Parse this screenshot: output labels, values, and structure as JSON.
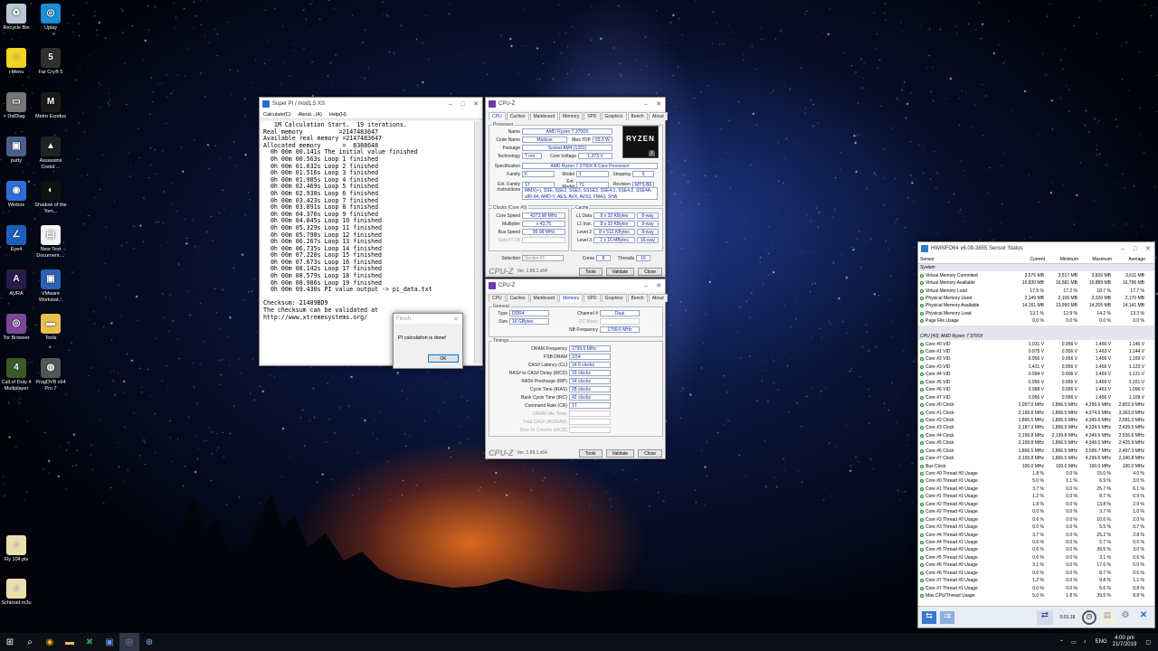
{
  "desktop": {
    "icons": [
      {
        "label": "Recycle Bin",
        "icon": "recycle-bin-icon",
        "color": "#b8c6d8",
        "glyph": "♻"
      },
      {
        "label": "Uplay",
        "icon": "uplay-icon",
        "color": "#1b8fd8",
        "glyph": "◎"
      },
      {
        "label": "i-Menu",
        "icon": "smiley-icon",
        "color": "#f4d320",
        "glyph": "☺"
      },
      {
        "label": "Far Cry® 5",
        "icon": "far-cry-5-icon",
        "color": "#303030",
        "glyph": "5"
      },
      {
        "label": "DslDiag",
        "icon": "dsldiag-icon",
        "color": "#777",
        "glyph": "▭"
      },
      {
        "label": "Metro Exodus",
        "icon": "metro-exodus-icon",
        "color": "#1a1a1a",
        "glyph": "M"
      },
      {
        "label": "putty",
        "icon": "putty-icon",
        "color": "#4a5e8c",
        "glyph": "▣"
      },
      {
        "label": "Assassins Creed ...",
        "icon": "assassins-creed-icon",
        "color": "#222",
        "glyph": "▲"
      },
      {
        "label": "Winbox",
        "icon": "winbox-icon",
        "color": "#2d6fd8",
        "glyph": "◉"
      },
      {
        "label": "Shadow of the Tom...",
        "icon": "shadow-tomb-raider-icon",
        "color": "#111",
        "glyph": "◐"
      },
      {
        "label": "Eye4",
        "icon": "eye4-icon",
        "color": "#1c5fbc",
        "glyph": "∠"
      },
      {
        "label": "New Text Document....",
        "icon": "text-document-icon",
        "color": "#f4f4f4",
        "glyph": "▤"
      },
      {
        "label": "AURA",
        "icon": "aura-icon",
        "color": "#2a1a4a",
        "glyph": "A"
      },
      {
        "label": "VMware Workstat...",
        "icon": "vmware-icon",
        "color": "#2b62b4",
        "glyph": "▣"
      },
      {
        "label": "Tor Browser",
        "icon": "tor-browser-icon",
        "color": "#7d4698",
        "glyph": "◎"
      },
      {
        "label": "Tools",
        "icon": "folder-icon",
        "color": "#e8c050",
        "glyph": "▬"
      },
      {
        "label": "Call of Duty 4 Multiplayer",
        "icon": "call-of-duty-icon",
        "color": "#3a5a2a",
        "glyph": "4"
      },
      {
        "label": "ProgDVB x64 Pro 7",
        "icon": "progdvb-icon",
        "color": "#555",
        "glyph": "◍"
      },
      {
        "label": "Fly 104.pls",
        "icon": "playlist-file-icon",
        "color": "#e9e0b0",
        "glyph": "♫"
      },
      {
        "label": "Schizoid.m3u",
        "icon": "m3u-file-icon",
        "color": "#e9e0b0",
        "glyph": "♫"
      }
    ]
  },
  "superpi": {
    "title": "Super PI / mod1.5 XS",
    "menu": [
      "Calculate(C)",
      "About...(A)",
      "Help(H)"
    ],
    "lines": [
      "   1M Calculation Start.  19 iterations.",
      "Real memory          =2147483647",
      "Available real memory =2147483647",
      "Allocated memory      =  8388648",
      "  0h 00m 00.141s The initial value finished",
      "  0h 00m 00.563s Loop 1 finished",
      "  0h 00m 01.032s Loop 2 finished",
      "  0h 00m 01.516s Loop 3 finished",
      "  0h 00m 01.985s Loop 4 finished",
      "  0h 00m 02.469s Loop 5 finished",
      "  0h 00m 02.938s Loop 6 finished",
      "  0h 00m 03.423s Loop 7 finished",
      "  0h 00m 03.891s Loop 8 finished",
      "  0h 00m 04.376s Loop 9 finished",
      "  0h 00m 04.845s Loop 10 finished",
      "  0h 00m 05.329s Loop 11 finished",
      "  0h 00m 05.798s Loop 12 finished",
      "  0h 00m 06.267s Loop 13 finished",
      "  0h 00m 06.735s Loop 14 finished",
      "  0h 00m 07.220s Loop 15 finished",
      "  0h 00m 07.673s Loop 16 finished",
      "  0h 00m 08.142s Loop 17 finished",
      "  0h 00m 08.579s Loop 18 finished",
      "  0h 00m 08.986s Loop 19 finished",
      "  0h 00m 09.430s PI value output -> pi_data.txt",
      "",
      "Checksum: 21489BD9",
      "The checksum can be validated at",
      "http://www.xtremesystems.org/"
    ]
  },
  "finish": {
    "title": "Finish",
    "message": "PI calculation is done!",
    "ok": "OK"
  },
  "cpuz1": {
    "title": "CPU-Z",
    "tabs": [
      "CPU",
      "Caches",
      "Mainboard",
      "Memory",
      "SPD",
      "Graphics",
      "Bench",
      "About"
    ],
    "active": 0,
    "processor_title": "Processor",
    "name_l": "Name",
    "name": "AMD Ryzen 7 3700X",
    "code_l": "Code Name",
    "code": "Matisse",
    "tdp_l": "Max TDP",
    "tdp": "65.0 W",
    "pkg_l": "Package",
    "pkg": "Socket AM4 (1331)",
    "tech_l": "Technology",
    "tech": "7 nm",
    "volt_l": "Core Voltage",
    "volt": "1.373 V",
    "spec_l": "Specification",
    "spec": "AMD Ryzen 7 3700X 8-Core Processor",
    "fam_l": "Family",
    "fam": "F",
    "model_l": "Model",
    "model": "1",
    "step_l": "Stepping",
    "step": "0",
    "efam_l": "Ext. Family",
    "efam": "17",
    "emodel_l": "Ext. Model",
    "emodel": "71",
    "rev_l": "Revision",
    "rev": "MTS-B0",
    "inst_l": "Instructions",
    "inst1": "MMX(+), SSE, SSE2, SSE3, SSSE3, SSE4.1, SSE4.2, SSE4A,",
    "inst2": "x86-64, AMD-V, AES, AVX, AVX2, FMA3, SHA",
    "logo_text": "RYZEN",
    "logo_sub": "7",
    "clocks_title": "Clocks (Core #0)",
    "cs_l": "Core Speed",
    "cs": "4373.98 MHz",
    "mul_l": "Multiplier",
    "mul": "x 43.75",
    "bus_l": "Bus Speed",
    "bus": "99.98 MHz",
    "fsb_l": "Rated FSB",
    "cache_title": "Cache",
    "caches": [
      {
        "l": "L1 Data",
        "v": "8 x 32 KBytes",
        "w": "8-way"
      },
      {
        "l": "L1 Inst.",
        "v": "8 x 32 KBytes",
        "w": "8-way"
      },
      {
        "l": "Level 2",
        "v": "8 x 512 KBytes",
        "w": "8-way"
      },
      {
        "l": "Level 3",
        "v": "2 x 16 MBytes",
        "w": "16-way"
      }
    ],
    "sel_l": "Selection",
    "sel": "Socket #1",
    "cores_l": "Cores",
    "cores": "8",
    "threads_l": "Threads",
    "threads": "16",
    "ver": "Ver. 1.89.1.x64",
    "tools": "Tools",
    "validate": "Validate",
    "close": "Close",
    "brand": "CPU-Z"
  },
  "cpuz2": {
    "title": "CPU-Z",
    "active": 3,
    "general_title": "General",
    "type_l": "Type",
    "type": "DDR4",
    "chan_l": "Channel #",
    "chan": "Dual",
    "size_l": "Size",
    "size": "16 GBytes",
    "dc_l": "DC Mode",
    "nb_l": "NB Frequency",
    "nb": "1799.6 MHz",
    "timings_title": "Timings",
    "timings": [
      {
        "l": "DRAM Frequency",
        "v": "1799.6 MHz"
      },
      {
        "l": "FSB:DRAM",
        "v": "3:54"
      },
      {
        "l": "CAS# Latency (CL)",
        "v": "14.0 clocks"
      },
      {
        "l": "RAS# to CAS# Delay (tRCD)",
        "v": "15 clocks"
      },
      {
        "l": "RAS# Precharge (tRP)",
        "v": "14 clocks"
      },
      {
        "l": "Cycle Time (tRAS)",
        "v": "28 clocks"
      },
      {
        "l": "Bank Cycle Time (tRC)",
        "v": "42 clocks"
      },
      {
        "l": "Command Rate (CR)",
        "v": "1T"
      },
      {
        "l": "DRAM Idle Timer",
        "v": ""
      },
      {
        "l": "Total CAS# (tRDRAM)",
        "v": ""
      },
      {
        "l": "Row To Column (tRCD)",
        "v": ""
      }
    ],
    "ver": "Ver. 1.89.1.x64",
    "tools": "Tools",
    "validate": "Validate",
    "close": "Close",
    "brand": "CPU-Z"
  },
  "hwinfo": {
    "title": "HWiNFO64 v6.09-3855 Sensor Status",
    "headers": [
      "Sensor",
      "Current",
      "Minimum",
      "Maximum",
      "Average"
    ],
    "rows": [
      {
        "s": 1,
        "n": "System"
      },
      {
        "n": "Virtual Memory Commited",
        "c": "3,576 MB",
        "mi": "3,517 MB",
        "ma": "3,826 MB",
        "a": "3,611 MB"
      },
      {
        "n": "Virtual Memory Available",
        "c": "16,830 MB",
        "mi": "16,581 MB",
        "ma": "16,889 MB",
        "a": "16,796 MB"
      },
      {
        "n": "Virtual Memory Load",
        "c": "17.5 %",
        "mi": "17.2 %",
        "ma": "18.7 %",
        "a": "17.7 %"
      },
      {
        "n": "Physical Memory Used",
        "c": "2,149 MB",
        "mi": "2,106 MB",
        "ma": "2,320 MB",
        "a": "2,170 MB"
      },
      {
        "n": "Physical Memory Available",
        "c": "14,161 MB",
        "mi": "13,990 MB",
        "ma": "14,205 MB",
        "a": "14,141 MB"
      },
      {
        "n": "Physical Memory Load",
        "c": "13.1 %",
        "mi": "12.9 %",
        "ma": "14.2 %",
        "a": "13.3 %"
      },
      {
        "n": "Page File Usage",
        "c": "0.0 %",
        "mi": "0.0 %",
        "ma": "0.0 %",
        "a": "0.0 %"
      },
      {
        "s": 1,
        "n": ""
      },
      {
        "s": 1,
        "n": "CPU [#0]: AMD Ryzen 7 3700X"
      },
      {
        "n": "Core #0 VID",
        "c": "1.031 V",
        "mi": "0.956 V",
        "ma": "1.456 V",
        "a": "1.146 V"
      },
      {
        "n": "Core #1 VID",
        "c": "0.975 V",
        "mi": "0.956 V",
        "ma": "1.463 V",
        "a": "1.144 V"
      },
      {
        "n": "Core #2 VID",
        "c": "0.956 V",
        "mi": "0.956 V",
        "ma": "1.456 V",
        "a": "1.159 V"
      },
      {
        "n": "Core #3 VID",
        "c": "1.431 V",
        "mi": "0.956 V",
        "ma": "1.456 V",
        "a": "1.123 V"
      },
      {
        "n": "Core #4 VID",
        "c": "0.994 V",
        "mi": "0.906 V",
        "ma": "1.469 V",
        "a": "1.121 V"
      },
      {
        "n": "Core #5 VID",
        "c": "0.956 V",
        "mi": "0.956 V",
        "ma": "1.469 V",
        "a": "1.151 V"
      },
      {
        "n": "Core #6 VID",
        "c": "0.988 V",
        "mi": "0.956 V",
        "ma": "1.463 V",
        "a": "1.096 V"
      },
      {
        "n": "Core #7 VID",
        "c": "0.956 V",
        "mi": "0.956 V",
        "ma": "1.456 V",
        "a": "1.109 V"
      },
      {
        "n": "Core #0 Clock",
        "c": "2,057.0 MHz",
        "mi": "1,866.5 MHz",
        "ma": "4,299.6 MHz",
        "a": "2,802.9 MHz"
      },
      {
        "n": "Core #1 Clock",
        "c": "2,199.8 MHz",
        "mi": "1,866.5 MHz",
        "ma": "4,374.6 MHz",
        "a": "3,363.0 MHz"
      },
      {
        "n": "Core #2 Clock",
        "c": "1,866.5 MHz",
        "mi": "1,866.5 MHz",
        "ma": "4,349.6 MHz",
        "a": "2,581.0 MHz"
      },
      {
        "n": "Core #3 Clock",
        "c": "2,187.3 MHz",
        "mi": "1,866.5 MHz",
        "ma": "4,324.6 MHz",
        "a": "2,439.5 MHz"
      },
      {
        "n": "Core #4 Clock",
        "c": "2,199.8 MHz",
        "mi": "2,199.8 MHz",
        "ma": "4,349.6 MHz",
        "a": "2,536.6 MHz"
      },
      {
        "n": "Core #5 Clock",
        "c": "2,199.8 MHz",
        "mi": "1,866.5 MHz",
        "ma": "4,349.6 MHz",
        "a": "2,425.9 MHz"
      },
      {
        "n": "Core #6 Clock",
        "c": "1,866.5 MHz",
        "mi": "1,866.5 MHz",
        "ma": "3,599.7 MHz",
        "a": "2,497.3 MHz"
      },
      {
        "n": "Core #7 Clock",
        "c": "2,199.8 MHz",
        "mi": "1,866.5 MHz",
        "ma": "4,299.6 MHz",
        "a": "2,340.8 MHz"
      },
      {
        "n": "Bus Clock",
        "c": "100.0 MHz",
        "mi": "100.0 MHz",
        "ma": "100.0 MHz",
        "a": "100.0 MHz"
      },
      {
        "n": "Core #0 Thread #0 Usage",
        "c": "1.8 %",
        "mi": "0.0 %",
        "ma": "15.0 %",
        "a": "4.0 %"
      },
      {
        "n": "Core #0 Thread #1 Usage",
        "c": "5.0 %",
        "mi": "1.1 %",
        "ma": "6.9 %",
        "a": "3.0 %"
      },
      {
        "n": "Core #1 Thread #0 Usage",
        "c": "3.7 %",
        "mi": "0.0 %",
        "ma": "25.7 %",
        "a": "6.1 %"
      },
      {
        "n": "Core #1 Thread #1 Usage",
        "c": "1.2 %",
        "mi": "0.0 %",
        "ma": "8.7 %",
        "a": "0.9 %"
      },
      {
        "n": "Core #2 Thread #0 Usage",
        "c": "1.8 %",
        "mi": "0.0 %",
        "ma": "13.8 %",
        "a": "2.9 %"
      },
      {
        "n": "Core #2 Thread #1 Usage",
        "c": "0.0 %",
        "mi": "0.0 %",
        "ma": "3.7 %",
        "a": "1.0 %"
      },
      {
        "n": "Core #3 Thread #0 Usage",
        "c": "0.6 %",
        "mi": "0.0 %",
        "ma": "10.6 %",
        "a": "2.0 %"
      },
      {
        "n": "Core #3 Thread #1 Usage",
        "c": "0.0 %",
        "mi": "0.0 %",
        "ma": "5.5 %",
        "a": "0.7 %"
      },
      {
        "n": "Core #4 Thread #0 Usage",
        "c": "3.7 %",
        "mi": "0.0 %",
        "ma": "25.2 %",
        "a": "2.8 %"
      },
      {
        "n": "Core #4 Thread #1 Usage",
        "c": "0.6 %",
        "mi": "0.0 %",
        "ma": "5.7 %",
        "a": "0.6 %"
      },
      {
        "n": "Core #5 Thread #0 Usage",
        "c": "0.6 %",
        "mi": "0.0 %",
        "ma": "39.5 %",
        "a": "3.0 %"
      },
      {
        "n": "Core #5 Thread #1 Usage",
        "c": "0.6 %",
        "mi": "0.0 %",
        "ma": "3.1 %",
        "a": "0.6 %"
      },
      {
        "n": "Core #6 Thread #0 Usage",
        "c": "3.1 %",
        "mi": "0.0 %",
        "ma": "17.6 %",
        "a": "5.0 %"
      },
      {
        "n": "Core #6 Thread #1 Usage",
        "c": "0.6 %",
        "mi": "0.0 %",
        "ma": "8.7 %",
        "a": "0.6 %"
      },
      {
        "n": "Core #7 Thread #0 Usage",
        "c": "1.2 %",
        "mi": "0.0 %",
        "ma": "9.8 %",
        "a": "1.1 %"
      },
      {
        "n": "Core #7 Thread #1 Usage",
        "c": "0.0 %",
        "mi": "0.0 %",
        "ma": "5.6 %",
        "a": "0.8 %"
      },
      {
        "n": "Max CPU/Thread Usage",
        "c": "5.0 %",
        "mi": "1.8 %",
        "ma": "39.5 %",
        "a": "8.8 %"
      }
    ],
    "timer": "0:01:19"
  },
  "taskbar": {
    "lang": "ENG",
    "time": "4:00 pm",
    "date": "21/7/2019",
    "start_icon": "windows-start-icon",
    "search_icon": "search-icon"
  }
}
